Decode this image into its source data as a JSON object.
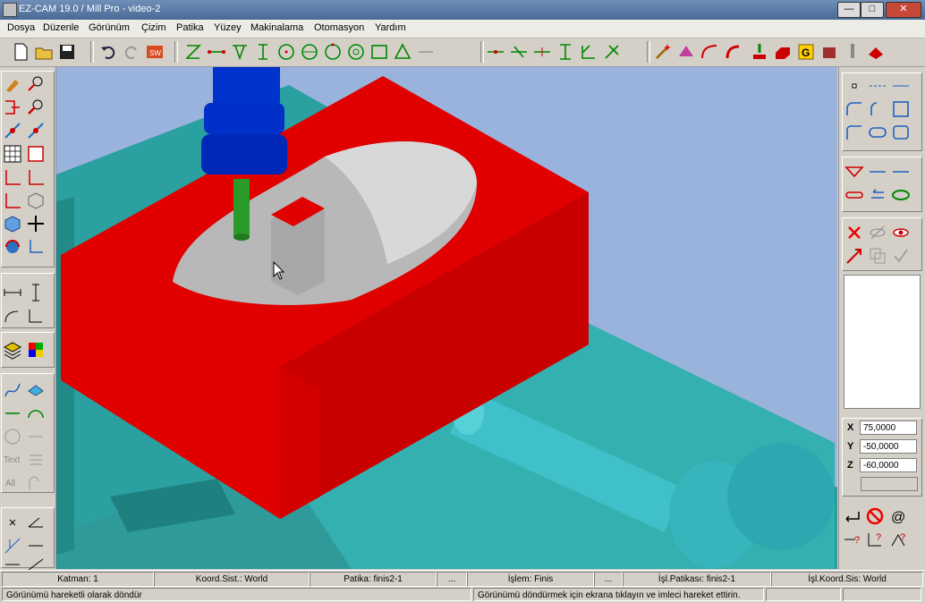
{
  "window": {
    "title": "EZ-CAM 19.0 / Mill Pro  - video-2"
  },
  "menu": [
    "Dosya",
    "Düzenle",
    "Görünüm",
    "Çizim",
    "Patika",
    "Yüzey",
    "Makinalama",
    "Otomasyon",
    "Yardım"
  ],
  "left_panel": {
    "text_label": "Text",
    "all_label": "All"
  },
  "coords": {
    "x_label": "X",
    "x": "75,0000",
    "y_label": "Y",
    "y": "-50,0000",
    "z_label": "Z",
    "z": "-60,0000"
  },
  "status_bar": {
    "layer": "Katman: 1",
    "coord_sys": "Koord.Sist.: World",
    "path": "Patika: finis2-1",
    "path_more": "...",
    "operation": "İşlem: Finis",
    "operation_more": "...",
    "op_path": "İşl.Patikası: finis2-1",
    "op_coord": "İşl.Koord.Sis: World"
  },
  "message_bar": {
    "left": "Görünümü hareketli olarak döndür",
    "right": "Görünümü döndürmek için ekrana tıklayın ve imleci hareket ettirin."
  },
  "colors": {
    "viewport_bg": "#9ab3dd",
    "vise": "#2fa8a8",
    "stock": "#e00000",
    "spindle": "#0033cc",
    "tool": "#2a9a2a"
  }
}
